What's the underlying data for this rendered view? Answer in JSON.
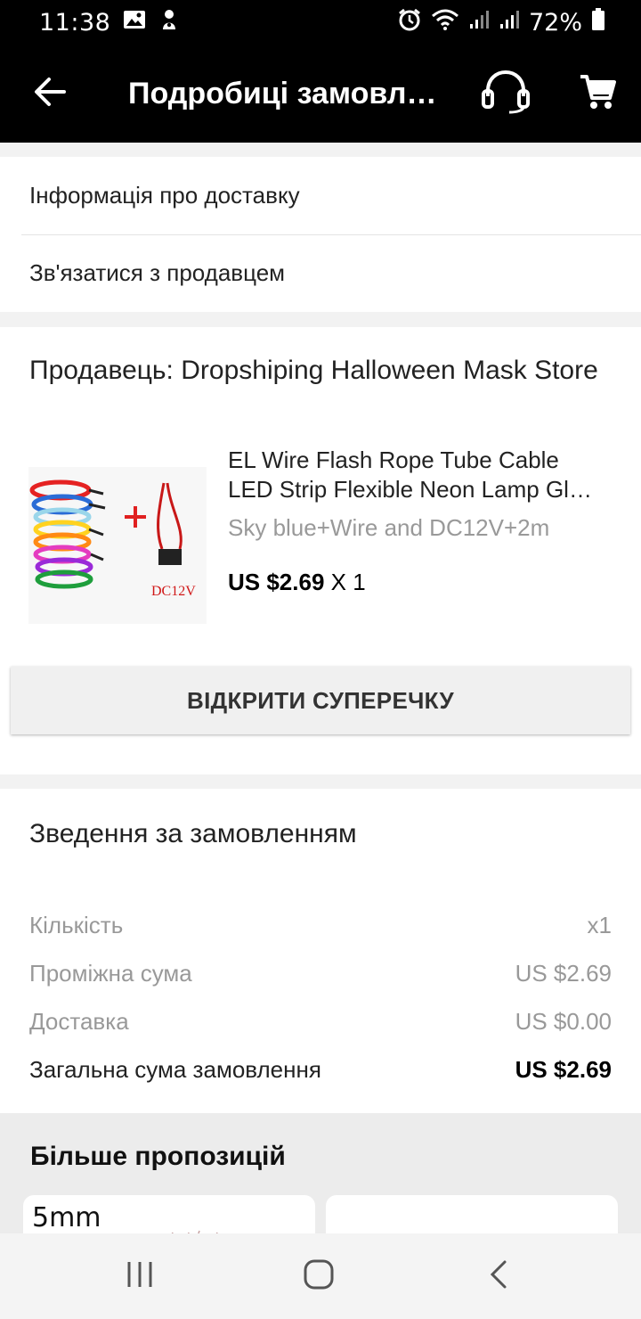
{
  "status_bar": {
    "time": "11:38",
    "battery": "72%",
    "icons": [
      "image-icon",
      "notification-icon",
      "alarm-icon",
      "wifi-icon",
      "signal-icon",
      "signal-icon",
      "battery-icon"
    ]
  },
  "app_bar": {
    "title": "Подробиці замовл…",
    "icons": [
      "back-arrow-icon",
      "headset-icon",
      "cart-icon"
    ]
  },
  "links": {
    "delivery_info": "Інформація про доставку",
    "contact_seller": "Зв'язатися з продавцем"
  },
  "order": {
    "seller": "Продавець: Dropshiping Halloween Mask Store",
    "product": {
      "title_line1": "EL Wire Flash Rope Tube Cable",
      "title_line2": "LED Strip Flexible Neon Lamp Gl…",
      "variant": "Sky blue+Wire and DC12V+2m",
      "price": "US $2.69",
      "quantity": "X 1",
      "image_label": "DC12V"
    },
    "dispute_button": "ВІДКРИТИ СУПЕРЕЧКУ"
  },
  "summary": {
    "title": "Зведення за замовленням",
    "rows": [
      {
        "label": "Кількість",
        "value": "x1"
      },
      {
        "label": "Проміжна сума",
        "value": "US $2.69"
      },
      {
        "label": "Доставка",
        "value": "US $0.00"
      },
      {
        "label": "Загальна сума замовлення",
        "value": "US $2.69"
      }
    ]
  },
  "more_offers": {
    "title": "Більше пропозицій",
    "tile1_tag": "5mm"
  },
  "colors": {
    "bar_background": "#000000",
    "card_background": "#ffffff",
    "page_background": "#f2f2f2",
    "muted_text": "#999999"
  }
}
